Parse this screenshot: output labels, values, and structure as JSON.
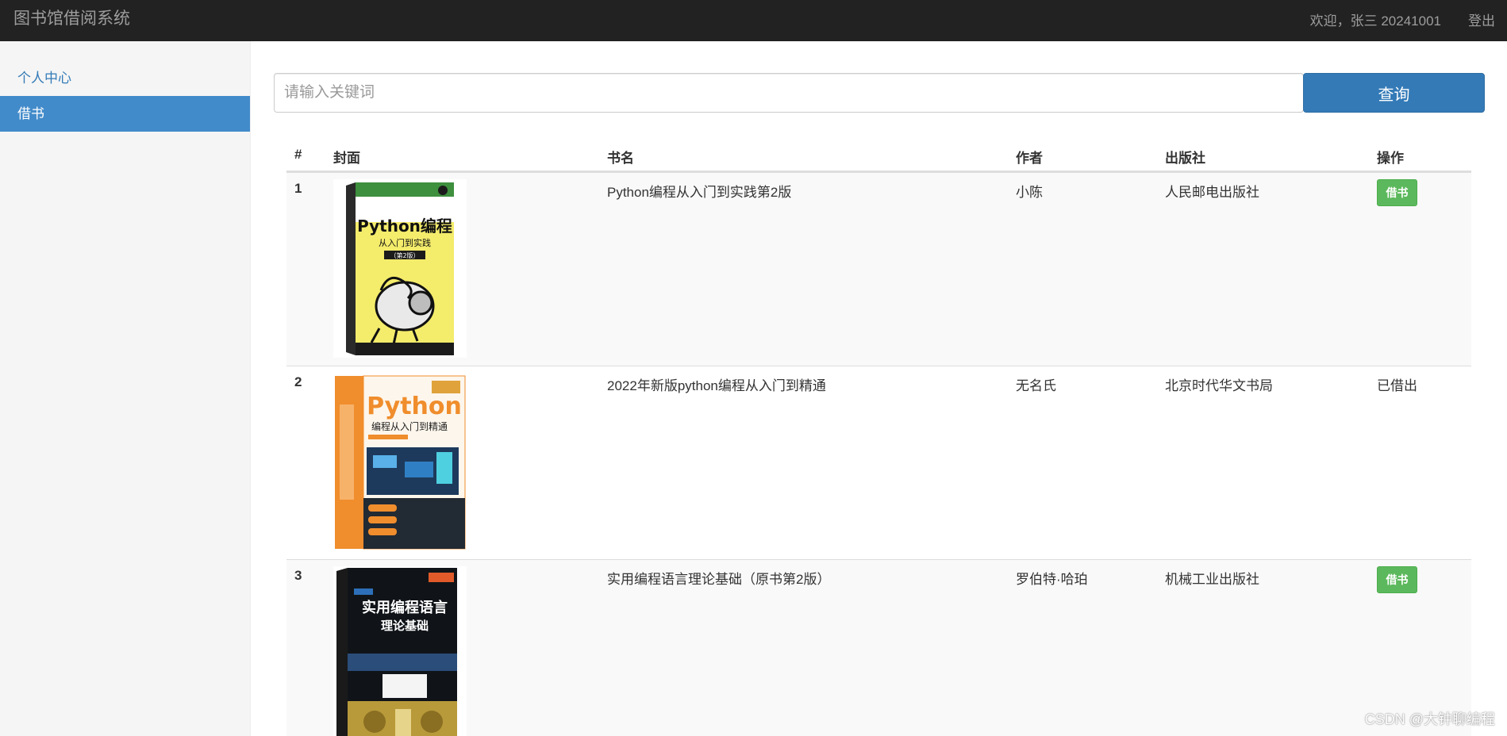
{
  "navbar": {
    "brand": "图书馆借阅系统",
    "welcome": "欢迎，张三 20241001",
    "logout": "登出"
  },
  "sidebar": {
    "items": [
      {
        "label": "个人中心",
        "active": false
      },
      {
        "label": "借书",
        "active": true
      }
    ]
  },
  "search": {
    "placeholder": "请输入关键词",
    "value": "",
    "button": "查询"
  },
  "table": {
    "headers": {
      "num": "#",
      "cover": "封面",
      "title": "书名",
      "author": "作者",
      "publisher": "出版社",
      "action": "操作"
    },
    "rows": [
      {
        "num": "1",
        "title": "Python编程从入门到实践第2版",
        "author": "小陈",
        "publisher": "人民邮电出版社",
        "action": "借书",
        "cover_image": "book-cover-python-crash-course"
      },
      {
        "num": "2",
        "title": "2022年新版python编程从入门到精通",
        "author": "无名氏",
        "publisher": "北京时代华文书局",
        "action": "已借出",
        "cover_image": "book-cover-python-beginner-to-master"
      },
      {
        "num": "3",
        "title": "实用编程语言理论基础（原书第2版）",
        "author": "罗伯特·哈珀",
        "publisher": "机械工业出版社",
        "action": "借书",
        "cover_image": "book-cover-programming-language-theory"
      }
    ]
  },
  "cover_art": {
    "book1": {
      "title": "Python编程",
      "subtitle": "从入门到实践",
      "edition": "（第2版）"
    },
    "book2": {
      "title": "Python",
      "subtitle": "编程从入门到精通"
    },
    "book3": {
      "title": "实用编程语言",
      "subtitle": "理论基础"
    }
  },
  "watermark": "CSDN @大钟聊编程",
  "colors": {
    "navbar": "#222222",
    "primary": "#337ab7",
    "active_sidebar": "#428bca",
    "success": "#5cb85c",
    "stripe": "#f9f9f9"
  }
}
